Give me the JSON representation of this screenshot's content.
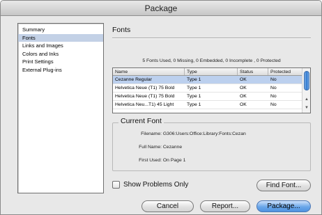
{
  "window": {
    "title": "Package"
  },
  "sidebar": {
    "items": [
      {
        "label": "Summary",
        "selected": false
      },
      {
        "label": "Fonts",
        "selected": true
      },
      {
        "label": "Links and Images",
        "selected": false
      },
      {
        "label": "Colors and Inks",
        "selected": false
      },
      {
        "label": "Print Settings",
        "selected": false
      },
      {
        "label": "External Plug-ins",
        "selected": false
      }
    ]
  },
  "fonts_panel": {
    "title": "Fonts",
    "summary": "5 Fonts Used, 0 Missing, 0 Embedded, 0 Incomplete , 0 Protected",
    "columns": [
      "Name",
      "Type",
      "Status",
      "Protected"
    ],
    "rows": [
      {
        "name": "Cezanne Regular",
        "type": "Type 1",
        "status": "OK",
        "protected": "No",
        "selected": true
      },
      {
        "name": "Helvetica Neue (T1) 75 Bold",
        "type": "Type 1",
        "status": "OK",
        "protected": "No",
        "selected": false
      },
      {
        "name": "Helvetica Neue (T1) 75 Bold",
        "type": "Type 1",
        "status": "OK",
        "protected": "No",
        "selected": false
      },
      {
        "name": "Helvetica Neu...T1) 45 Light",
        "type": "Type 1",
        "status": "OK",
        "protected": "No",
        "selected": false
      }
    ]
  },
  "current_font": {
    "title": "Current Font",
    "filename_label": "Filename:",
    "filename_value": "G306:Users:Office:Library:Fonts:Cezan",
    "fullname_label": "Full Name:",
    "fullname_value": "Cezanne",
    "firstused_label": "First Used:",
    "firstused_value": "On Page 1"
  },
  "options": {
    "show_problems_label": "Show Problems Only",
    "show_problems_checked": false
  },
  "buttons": {
    "find_font": "Find Font...",
    "cancel": "Cancel",
    "report": "Report...",
    "package": "Package..."
  },
  "colors": {
    "selection": "#c3d1e6",
    "default_button": "#4f93e0"
  }
}
